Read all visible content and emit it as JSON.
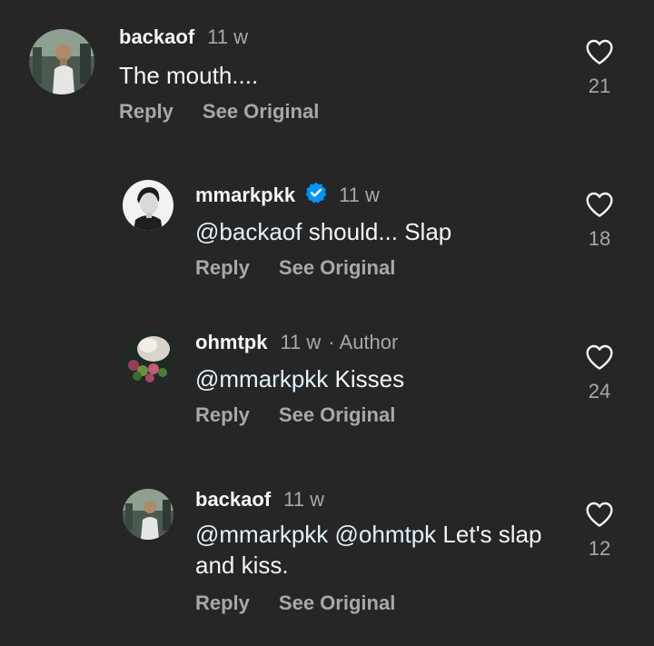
{
  "comments": [
    {
      "username": "backaof",
      "time": "11 w",
      "author_tag": "",
      "verified": false,
      "mentions": [],
      "text": "The mouth....",
      "reply_label": "Reply",
      "see_original_label": "See Original",
      "likes": "21",
      "icon": "heart-outline-icon"
    },
    {
      "username": "mmarkpkk",
      "time": "11 w",
      "author_tag": "",
      "verified": true,
      "mentions": [
        "@backaof"
      ],
      "text": "should... Slap",
      "reply_label": "Reply",
      "see_original_label": "See Original",
      "likes": "18",
      "icon": "heart-outline-icon"
    },
    {
      "username": "ohmtpk",
      "time": "11 w",
      "author_tag": "· Author",
      "verified": false,
      "mentions": [
        "@mmarkpkk"
      ],
      "text": "Kisses",
      "reply_label": "Reply",
      "see_original_label": "See Original",
      "likes": "24",
      "icon": "heart-outline-icon"
    },
    {
      "username": "backaof",
      "time": "11 w",
      "author_tag": "",
      "verified": false,
      "mentions": [
        "@mmarkpkk",
        "@ohmtpk"
      ],
      "text": "Let's slap and kiss.",
      "reply_label": "Reply",
      "see_original_label": "See Original",
      "likes": "12",
      "icon": "heart-outline-icon"
    }
  ],
  "colors": {
    "background": "#262626",
    "primary_text": "#f5f5f5",
    "secondary_text": "#a8a8a8",
    "verified_badge": "#0095f6",
    "mention": "#e0f1ff"
  }
}
